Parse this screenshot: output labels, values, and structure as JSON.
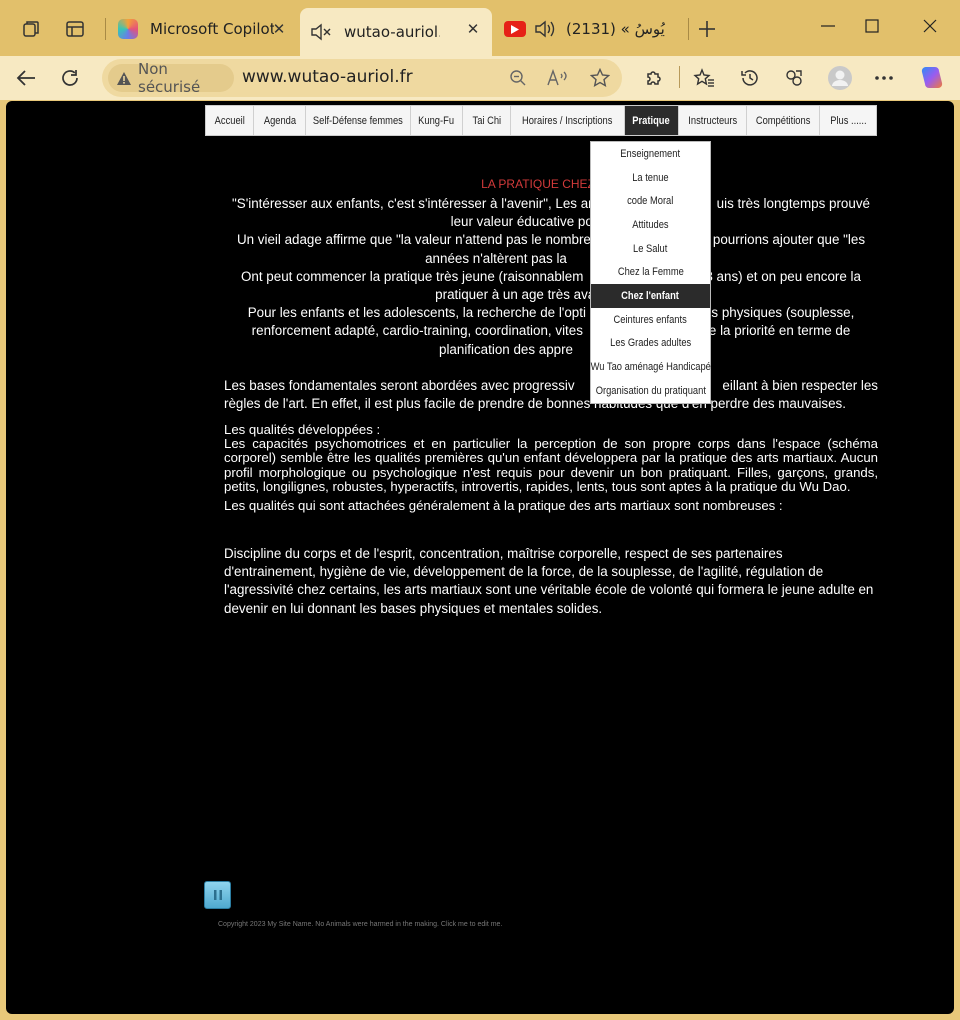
{
  "browser": {
    "tabs": [
      {
        "title": "Microsoft Copilot: ",
        "icon": "copilot-favicon",
        "active": false
      },
      {
        "title": "wutao-auriol.fr",
        "icon": "muted-speaker-icon",
        "active": true
      },
      {
        "title": "(2131) « يُوسُ",
        "icon": "youtube-icon",
        "active": false
      }
    ],
    "address": {
      "security_label": "Non sécurisé",
      "url": "www.wutao-auriol.fr"
    },
    "colors": {
      "frame": "#e2c06b",
      "toolbar": "#f7e9c2"
    }
  },
  "site": {
    "nav": [
      "Accueil",
      "Agenda",
      "Self-Défense femmes",
      "Kung-Fu",
      "Tai Chi",
      "Horaires / Inscriptions",
      "Pratique",
      "Instructeurs",
      "Compétitions",
      "Plus ......"
    ],
    "nav_active": "Pratique",
    "dropdown": [
      "Enseignement",
      "La tenue",
      "code Moral",
      "Attitudes",
      "Le Salut",
      "Chez la Femme",
      "Chez l'enfant",
      "Ceintures enfants",
      "Les Grades adultes",
      "Wu Tao aménagé Handicapé",
      "Organisation du pratiquant"
    ],
    "dropdown_active": "Chez l'enfant",
    "heading": "LA PRATIQUE CHEZ LES",
    "center_paragraphs": [
      "\"S'intéresser aux enfants, c'est s'intéresser à l'avenir\", Les ar",
      "uis très  longtemps prouvé",
      "leur valeur éducative  pour l",
      "Un vieil adage affirme que \"la valeur n'attend pas le nombre",
      "pourrions ajouter que \"les",
      "années n'altèrent pas la",
      "Ont peut commencer la pratique très jeune (raisonnablem",
      "3 ans) et on peu encore la",
      "pratiquer  à un age très avance",
      "Pour les enfants et les adolescents, la recherche  de l'opti",
      "és physiques (souplesse,",
      "renforcement adapté, cardio-training, coordination, vites",
      "e la priorité en terme de",
      "planification des appre"
    ],
    "bases_paragraph_a": "Les bases fondamentales seront abordées avec progressiv",
    "bases_paragraph_b": "eillant à   bien respecter les",
    "bases_paragraph_c": "règles de l'art. En effet, il est plus facile de prendre de bonnes habitudes que d'en perdre des mauvaises.",
    "qualities_title": "Les qualités développées  :",
    "qualities_text": "Les capacités psychomotrices et en particulier la perception de son propre corps dans l'espace (schéma corporel) semble être les qualités premières qu'un enfant développera par la pratique des arts martiaux. Aucun profil morphologique ou psychologique n'est requis pour devenir un bon pratiquant. Filles, garçons, grands, petits, longilignes, robustes, hyperactifs,  introvertis, rapides, lents,  tous sont aptes à la pratique du Wu Dao.",
    "qualities_martial": "Les qualités qui sont attachées généralement à la pratique des arts martiaux sont nombreuses :",
    "discipline_text": "Discipline du corps et de l'esprit, concentration, maîtrise  corporelle, respect de ses partenaires d'entrainement, hygiène de vie, développement de la force, de la souplesse, de l'agilité, régulation de l'agressivité chez certains, les arts martiaux sont une véritable école de volonté qui formera le jeune adulte en devenir en lui donnant les bases physiques et mentales solides.",
    "footer": "Copyright 2023 My Site Name. No Animals were harmed in the making. Click me to edit me.",
    "colors": {
      "background": "#000000",
      "heading": "#d23a3a"
    }
  }
}
